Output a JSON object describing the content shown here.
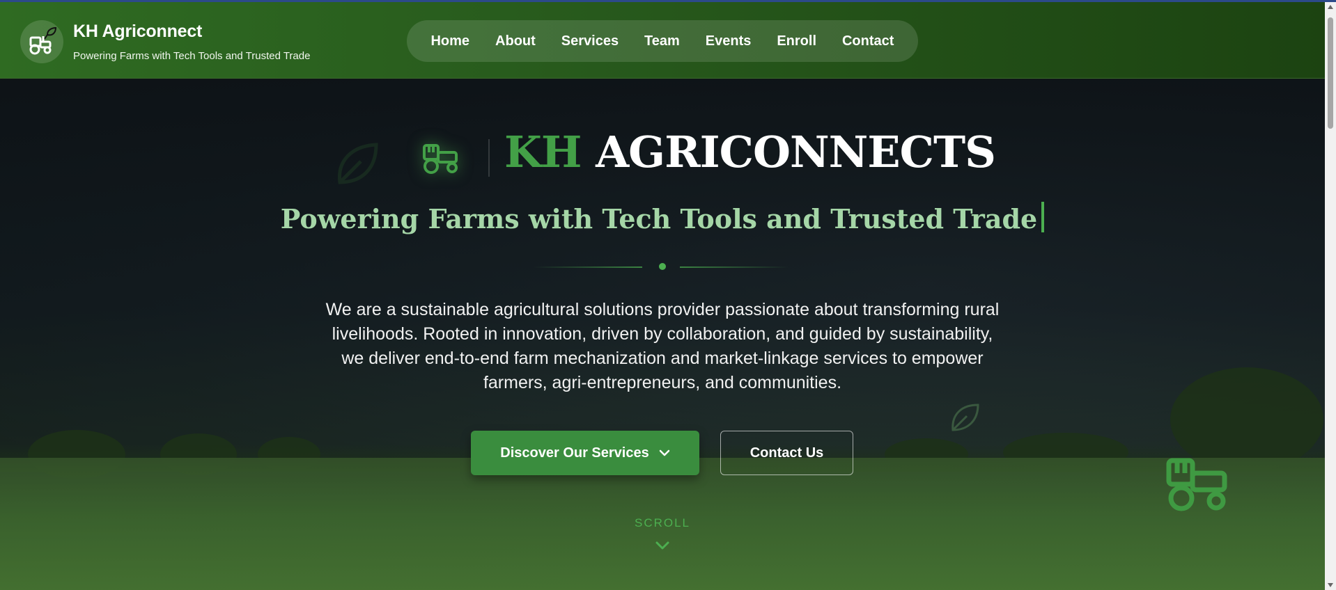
{
  "colors": {
    "brand_green": "#43a047",
    "header_green": "#2f6b22",
    "tagline_green": "#a5d6a7",
    "button_green": "#3a8d3e"
  },
  "header": {
    "title": "KH Agriconnect",
    "subtitle": "Powering Farms with Tech Tools and Trusted Trade",
    "logo_icon": "tractor-leaf-icon"
  },
  "nav": {
    "items": [
      {
        "label": "Home"
      },
      {
        "label": "About"
      },
      {
        "label": "Services"
      },
      {
        "label": "Team"
      },
      {
        "label": "Events"
      },
      {
        "label": "Enroll"
      },
      {
        "label": "Contact"
      }
    ]
  },
  "hero": {
    "title_highlight": "KH",
    "title_rest": "AGRICONNECTS",
    "tagline": "Powering Farms with Tech Tools and Trusted Trade",
    "description": "We are a sustainable agricultural solutions provider passionate about transforming rural livelihoods. Rooted in innovation, driven by collaboration, and guided by sustainability, we deliver end-to-end farm mechanization and market-linkage services to empower farmers, agri-entrepreneurs, and communities.",
    "primary_button": "Discover Our Services",
    "secondary_button": "Contact Us",
    "scroll_label": "SCROLL"
  }
}
